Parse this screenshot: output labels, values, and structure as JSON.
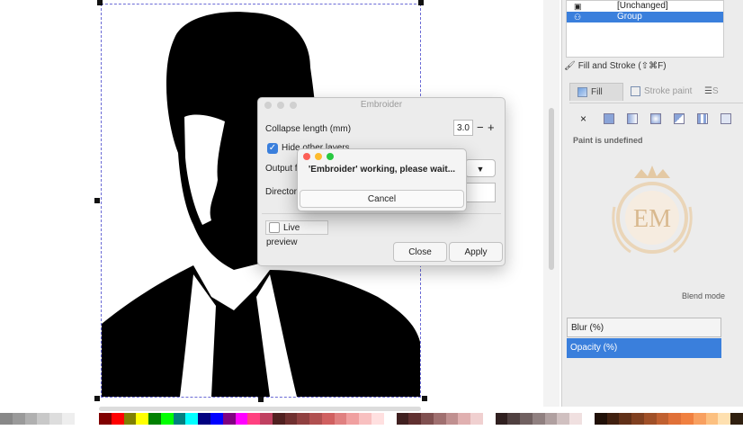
{
  "colors": {
    "selection_blue": "#3a7fdc",
    "dashed_bbox": "#6b6bd6",
    "silhouette": "#000000"
  },
  "objects_panel": {
    "rows": [
      {
        "label": "[Unchanged]",
        "selected": false,
        "icon": "object-icon"
      },
      {
        "label": "Group",
        "selected": true,
        "icon": "group-icon"
      }
    ]
  },
  "fill_stroke": {
    "title": "Fill and Stroke (⇧⌘F)",
    "tabs": [
      {
        "label": "Fill",
        "active": true
      },
      {
        "label": "Stroke paint",
        "active": false
      },
      {
        "label": "S",
        "active": false
      }
    ],
    "paint_types": [
      "none-icon",
      "flat-color-icon",
      "linear-gradient-icon",
      "radial-gradient-icon",
      "mesh-gradient-icon",
      "pattern-icon",
      "swatch-icon"
    ],
    "paint_none_glyph": "×",
    "paint_status": "Paint is undefined",
    "blend_label": "Blend mode",
    "blur_label": "Blur (%)",
    "opacity_label": "Opacity (%)"
  },
  "embroider_dialog": {
    "title": "Embroider",
    "collapse_label": "Collapse length (mm)",
    "collapse_value": "3.0",
    "minus": "−",
    "plus": "+",
    "hide_layers_label": "Hide other layers",
    "hide_layers_check": "✓",
    "output_label": "Output fil",
    "output_dropdown_glyph": "▼",
    "directory_label": "Directory",
    "live_preview_label": "Live preview",
    "close_label": "Close",
    "apply_label": "Apply"
  },
  "progress_popup": {
    "message": "'Embroider' working, please wait...",
    "cancel_label": "Cancel"
  },
  "watermark": {
    "text": "EM"
  },
  "palette": [
    "#888888",
    "#9a9a9a",
    "#b0b0b0",
    "#c8c8c8",
    "#dddddd",
    "#eeeeee",
    "#ffffff",
    "#ffffff",
    "#800000",
    "#ff0000",
    "#808000",
    "#ffff00",
    "#008000",
    "#00ff00",
    "#008080",
    "#00ffff",
    "#000080",
    "#0000ff",
    "#800080",
    "#ff00ff",
    "#ff4080",
    "#c04060",
    "#502020",
    "#703030",
    "#904040",
    "#b05050",
    "#d06060",
    "#e08080",
    "#f0a0a0",
    "#f8c0c0",
    "#ffe0e0",
    "#ffffff",
    "#402020",
    "#603030",
    "#805050",
    "#a07070",
    "#c09090",
    "#e0b0b0",
    "#f0d0d0",
    "#ffffff",
    "#302020",
    "#504040",
    "#706060",
    "#908080",
    "#b0a0a0",
    "#d0c0c0",
    "#f0e0e0",
    "#ffffff",
    "#201008",
    "#402010",
    "#603018",
    "#804020",
    "#a05028",
    "#c06030",
    "#e07038",
    "#f08040",
    "#f8a060",
    "#fcc080",
    "#fee0b0",
    "#302010"
  ]
}
